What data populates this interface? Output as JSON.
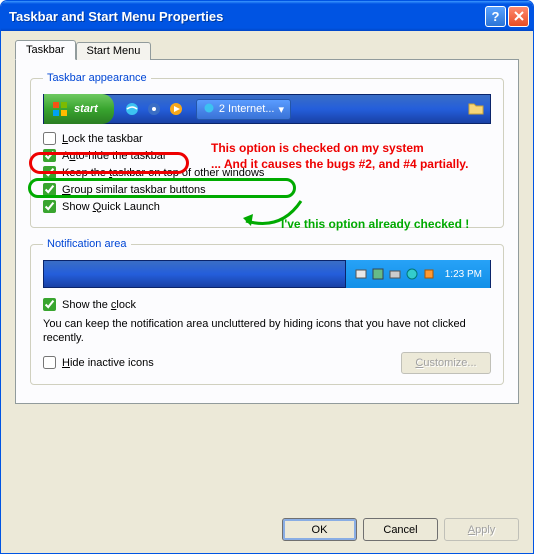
{
  "window": {
    "title": "Taskbar and Start Menu Properties"
  },
  "tabs": {
    "taskbar": "Taskbar",
    "startmenu": "Start Menu"
  },
  "groupbox1": {
    "legend": "Taskbar appearance",
    "start_label": "start",
    "task_label": "2 Internet...",
    "chk_lock": "Lock the taskbar",
    "chk_autohide": "Auto-hide the taskbar",
    "chk_ontop": "Keep the taskbar on top of other windows",
    "chk_group": "Group similar taskbar buttons",
    "chk_quicklaunch": "Show Quick Launch"
  },
  "groupbox2": {
    "legend": "Notification area",
    "time": "1:23 PM",
    "chk_clock": "Show the clock",
    "hint": "You can keep the notification area uncluttered by hiding icons that you have not clicked recently.",
    "chk_hide": "Hide inactive icons",
    "customize": "Customize..."
  },
  "buttons": {
    "ok": "OK",
    "cancel": "Cancel",
    "apply": "Apply"
  },
  "annotations": {
    "red1": "This option is checked on my system",
    "red2": "... And it causes the bugs #2, and #4 partially.",
    "green": "I've this option already checked !"
  },
  "underline": {
    "lock": "L",
    "autohide": "u",
    "keep": "t",
    "group": "G",
    "ql": "Q",
    "clock": "c",
    "hide": "H",
    "customize": "C",
    "apply": "A"
  }
}
